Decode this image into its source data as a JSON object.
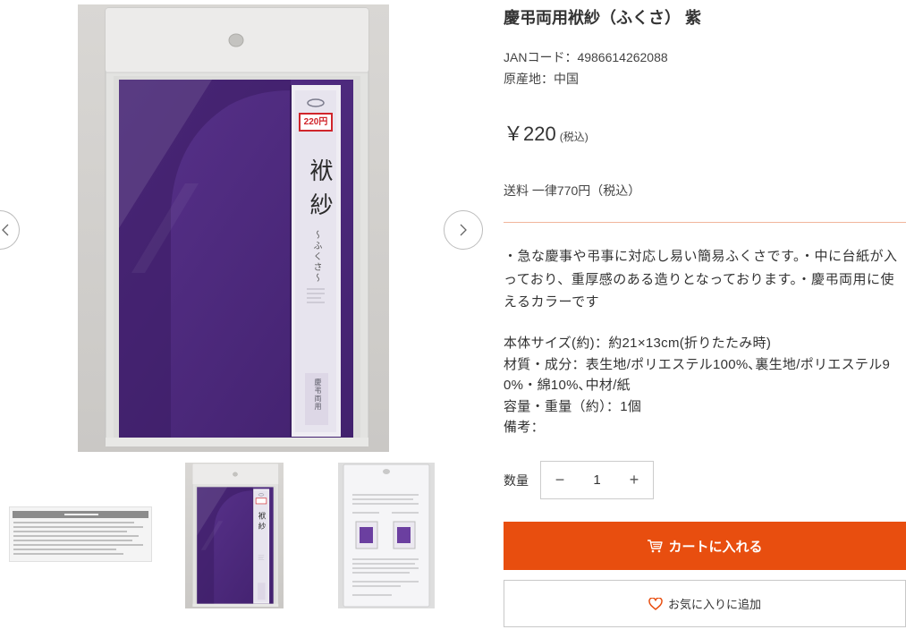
{
  "colors": {
    "accent": "#e84e0f",
    "divider": "#f1b59c",
    "text": "#333333",
    "cloth_purple": "#4b2879",
    "price_tag_red": "#d0252b"
  },
  "gallery": {
    "prev_icon": "chevron-left-icon",
    "next_icon": "chevron-right-icon",
    "main_image": {
      "package_label": {
        "price_tag": "220円",
        "title": "袱紗",
        "reading": "～ふくさ～",
        "usage": "慶弔両用"
      }
    }
  },
  "product": {
    "title": "慶弔両用袱紗（ふくさ） 紫",
    "jan_code": "JANコード：4986614262088",
    "origin": "原産地：中国",
    "price": "￥220",
    "price_tax_note": "(税込)",
    "shipping": "送料 一律770円（税込）",
    "description": "・急な慶事や弔事に対応し易い簡易ふくさです。・中に台紙が入っており、重厚感のある造りとなっております。・慶弔両用に使えるカラーです",
    "specs": [
      "本体サイズ(約)：約21×13cm(折りたたみ時)",
      "材質・成分：表生地/ポリエステル100%､裏生地/ポリエステル90%・綿10%､中材/紙",
      "容量・重量（約）：1個",
      "備考："
    ]
  },
  "quantity": {
    "label": "数量",
    "value": "1",
    "decrement_label": "−",
    "increment_label": "+"
  },
  "buttons": {
    "add_to_cart": "カートに入れる",
    "add_to_cart_icon": "cart-icon",
    "add_to_favorites": "お気に入りに追加",
    "add_to_favorites_icon": "heart-icon"
  }
}
